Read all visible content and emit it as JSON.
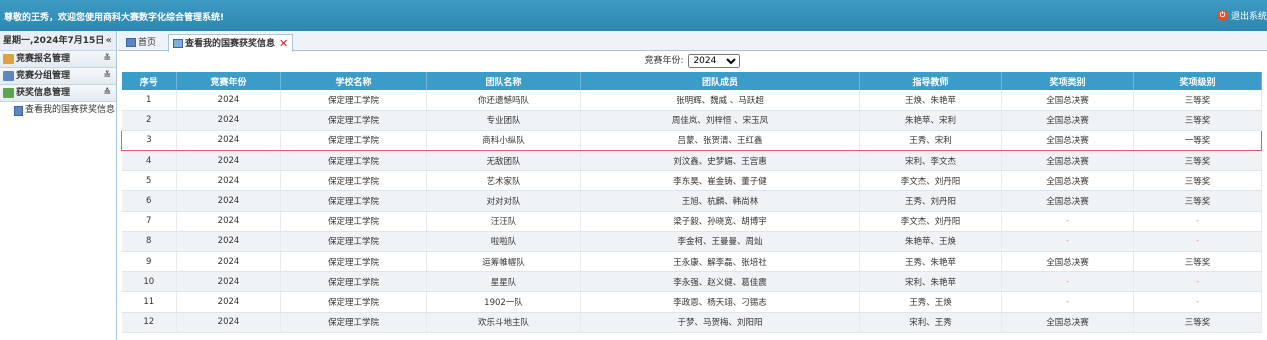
{
  "header": {
    "welcome": "尊敬的王秀，欢迎您使用商科大赛数字化综合管理系统!",
    "logout_label": "退出系统"
  },
  "sidebar": {
    "date": "星期一,2024年7月15日",
    "groups": [
      {
        "label": "竞赛报名管理"
      },
      {
        "label": "竞赛分组管理"
      },
      {
        "label": "获奖信息管理"
      }
    ],
    "sub_items": [
      {
        "label": "查看我的国赛获奖信息"
      }
    ]
  },
  "tabs": {
    "home_label": "首页",
    "active_label": "查看我的国赛获奖信息"
  },
  "filter": {
    "label": "竞赛年份:",
    "selected": "2024"
  },
  "table": {
    "headers": [
      "序号",
      "竞赛年份",
      "学校名称",
      "团队名称",
      "团队成员",
      "指导教师",
      "奖项类别",
      "奖项级别"
    ],
    "rows": [
      [
        "1",
        "2024",
        "保定理工学院",
        "你还遗憾吗队",
        "张明辉、魏威 、马跃超",
        "王焕、朱艳苹",
        "全国总决赛",
        "三等奖"
      ],
      [
        "2",
        "2024",
        "保定理工学院",
        "专业团队",
        "周佳岚、刘梓恒 、宋玉凤",
        "朱艳苹、宋利",
        "全国总决赛",
        "三等奖"
      ],
      [
        "3",
        "2024",
        "保定理工学院",
        "商科小纵队",
        "吕蒙、张贺清、王红鑫",
        "王秀、宋利",
        "全国总决赛",
        "一等奖"
      ],
      [
        "4",
        "2024",
        "保定理工学院",
        "无敌团队",
        "刘汶鑫、史梦媚、王宫惠",
        "宋利、李文杰",
        "全国总决赛",
        "三等奖"
      ],
      [
        "5",
        "2024",
        "保定理工学院",
        "艺术家队",
        "李东昊、崔金铸、董子健",
        "李文杰、刘丹阳",
        "全国总决赛",
        "三等奖"
      ],
      [
        "6",
        "2024",
        "保定理工学院",
        "对对对队",
        "王旭、杭麟、韩尚林",
        "王秀、刘丹阳",
        "全国总决赛",
        "三等奖"
      ],
      [
        "7",
        "2024",
        "保定理工学院",
        "汪汪队",
        "梁子毅、孙晓宽、胡博宇",
        "李文杰、刘丹阳",
        "-",
        "-"
      ],
      [
        "8",
        "2024",
        "保定理工学院",
        "啦啦队",
        "李金柯、王曼曼、周灿",
        "朱艳苹、王焕",
        "-",
        "-"
      ],
      [
        "9",
        "2024",
        "保定理工学院",
        "运筹帷幄队",
        "王永康、解李磊、张培社",
        "王秀、朱艳苹",
        "全国总决赛",
        "三等奖"
      ],
      [
        "10",
        "2024",
        "保定理工学院",
        "星星队",
        "李永强、赵义健、葛佳震",
        "宋利、朱艳苹",
        "-",
        "-"
      ],
      [
        "11",
        "2024",
        "保定理工学院",
        "1902一队",
        "李政恩、杨天翊、刁锡志",
        "王秀、王焕",
        "-",
        "-"
      ],
      [
        "12",
        "2024",
        "保定理工学院",
        "欢乐斗地主队",
        "于梦、马贺梅、刘阳阳",
        "宋利、王秀",
        "全国总决赛",
        "三等奖"
      ]
    ],
    "selected_row": 3
  }
}
